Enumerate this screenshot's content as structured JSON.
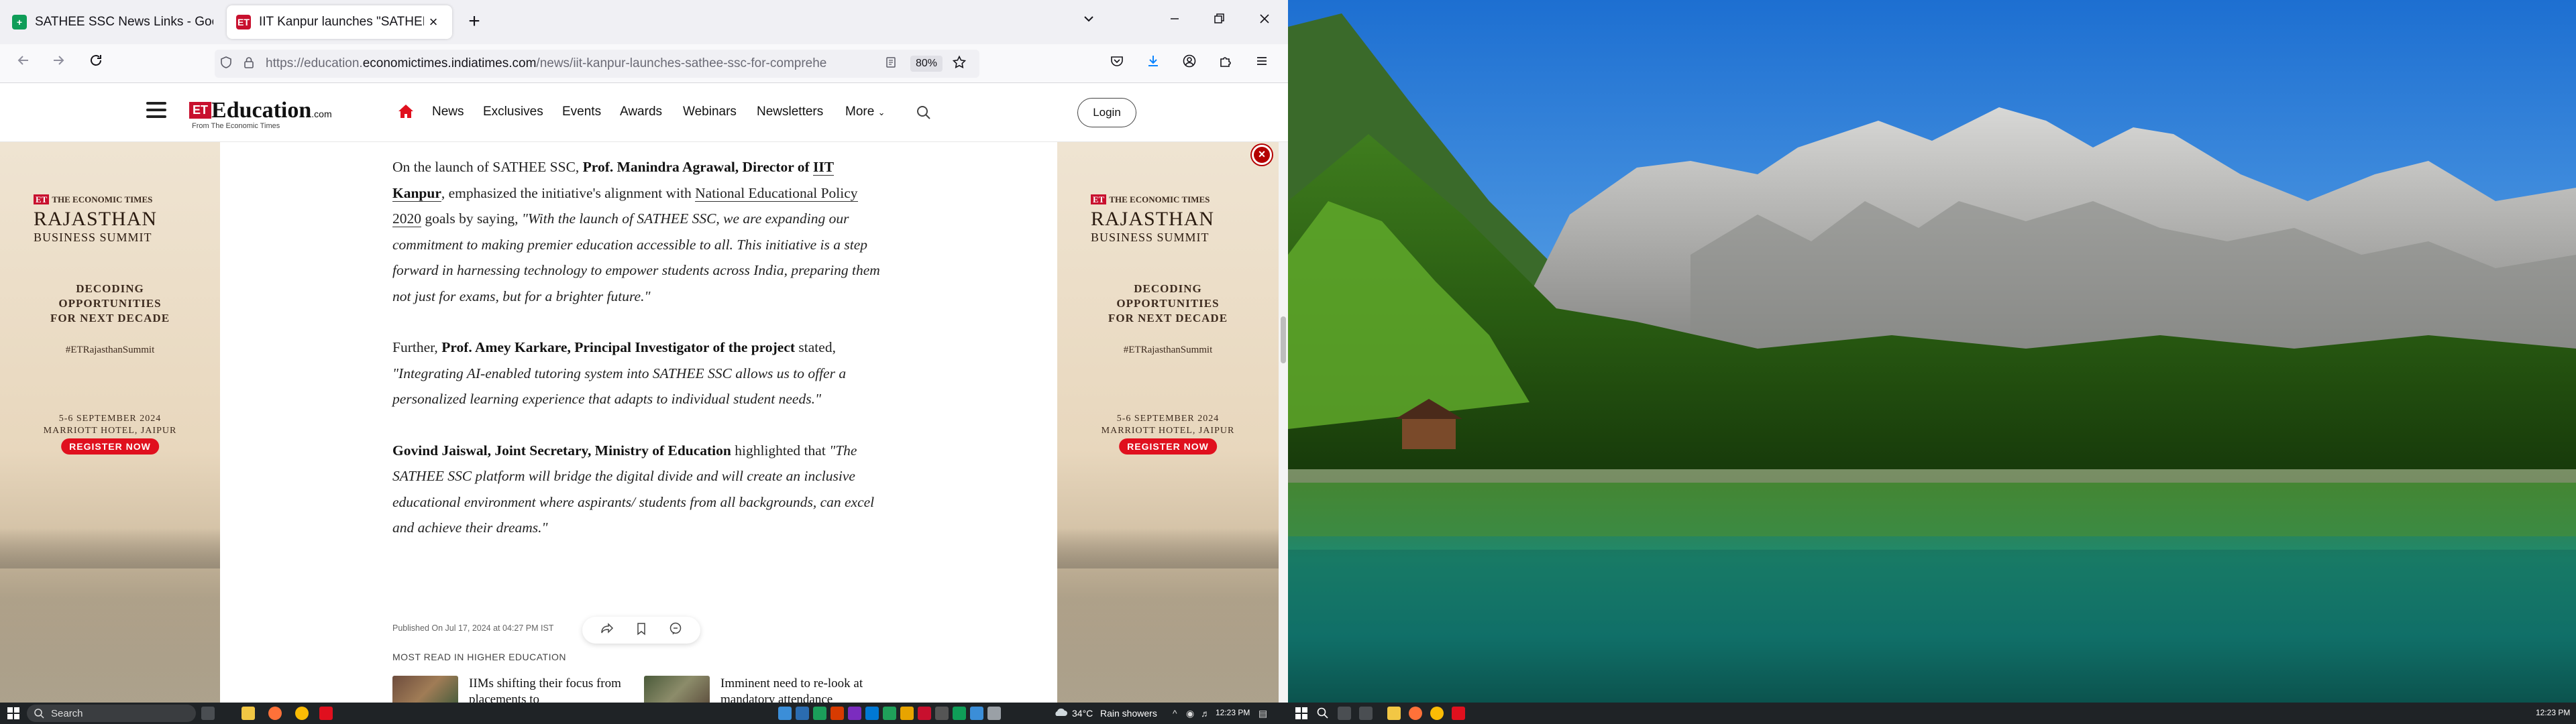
{
  "browser": {
    "tabs": [
      {
        "title": "SATHEE SSC News Links - Goog",
        "active": false
      },
      {
        "title": "IIT Kanpur launches \"SATHEE SS",
        "active": true
      }
    ],
    "url_prefix": "https://education.",
    "url_domain": "economictimes.indiatimes.com",
    "url_path": "/news/iit-kanpur-launches-sathee-ssc-for-comprehe",
    "zoom": "80%"
  },
  "site": {
    "logo_mark": "ET",
    "logo_name": "Education",
    "logo_domain": ".com",
    "logo_tagline": "From The Economic Times",
    "nav": [
      "News",
      "Exclusives",
      "Events",
      "Awards",
      "Webinars",
      "Newsletters",
      "More"
    ],
    "login": "Login"
  },
  "ad": {
    "brand": "THE ECONOMIC TIMES",
    "brand_mark": "ET",
    "title": "RAJASTHAN",
    "subtitle": "BUSINESS SUMMIT",
    "tagline_1": "DECODING",
    "tagline_2": "OPPORTUNITIES",
    "tagline_3": "FOR NEXT DECADE",
    "hashtag": "#ETRajasthanSummit",
    "date": "5-6 SEPTEMBER 2024",
    "venue": "MARRIOTT HOTEL, JAIPUR",
    "cta": "REGISTER NOW"
  },
  "article": {
    "p1_a": "On the launch of SATHEE SSC, ",
    "p1_b": "Prof. Manindra Agrawal, Director of ",
    "p1_c": "IIT Kanpur",
    "p1_d": ", emphasized the initiative's alignment with ",
    "p1_e": "National Educational Policy 2020",
    "p1_f": " goals by saying, ",
    "p1_g": "\"With the launch of SATHEE SSC, we are expanding our commitment to making premier education accessible to all. This initiative is a step forward in harnessing technology to empower students across India, preparing them not just for exams, but for a brighter future.\"",
    "p2_a": "Further, ",
    "p2_b": "Prof. Amey Karkare, Principal Investigator of the project",
    "p2_c": " stated, ",
    "p2_d": "\"Integrating AI-enabled tutoring system into SATHEE SSC allows us to offer a personalized learning experience that adapts to individual student needs.\"",
    "p3_a": "Govind Jaiswal, Joint Secretary, Ministry of Education",
    "p3_b": " highlighted that ",
    "p3_c": "\"The SATHEE SSC platform will bridge the digital divide and will create an inclusive educational environment where aspirants/ students from all backgrounds, can excel and achieve their dreams.\"",
    "published": "Published On Jul 17, 2024 at 04:27 PM IST",
    "most_read_heading": "MOST READ IN HIGHER EDUCATION",
    "most_read": [
      {
        "title": "IIMs shifting their focus from placements to"
      },
      {
        "title": "Imminent need to re-look at mandatory attendance"
      }
    ]
  },
  "taskbar": {
    "search_placeholder": "Search",
    "weather": "34°C",
    "weather_desc": "Rain showers",
    "time_left": "12:23 PM",
    "time_right": "12:23 PM"
  }
}
